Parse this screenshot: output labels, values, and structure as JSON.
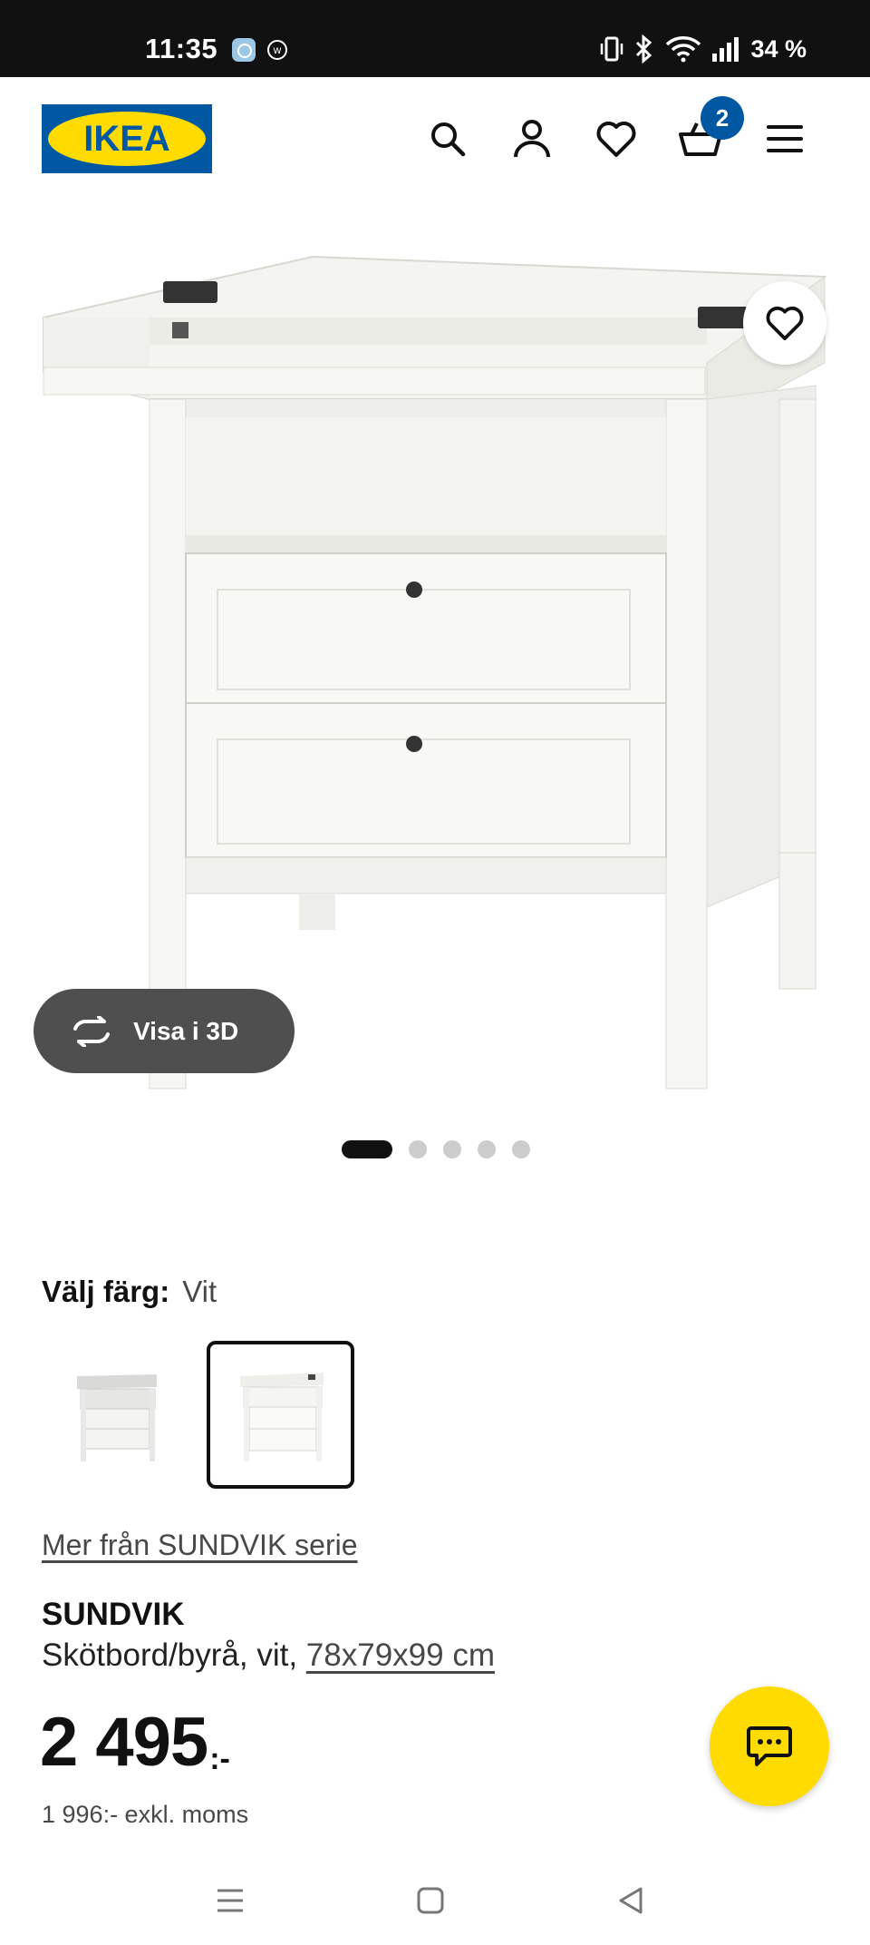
{
  "status_bar": {
    "time": "11:35",
    "battery": "34 %",
    "icons": [
      "vibrate-icon",
      "bluetooth-icon",
      "wifi-icon",
      "signal-icon"
    ]
  },
  "header": {
    "logo_text": "IKEA",
    "icons": [
      "search-icon",
      "account-icon",
      "heart-icon",
      "basket-icon",
      "menu-icon"
    ],
    "basket_count": "2"
  },
  "gallery": {
    "view3d_label": "Visa i 3D",
    "image_count": 5,
    "active_index": 0
  },
  "color": {
    "label": "Välj färg:",
    "value": "Vit",
    "swatches": [
      "grey-white",
      "white"
    ],
    "selected_index": 1
  },
  "product": {
    "series_link": "Mer från SUNDVIK serie",
    "name": "SUNDVIK",
    "description": "Skötbord/byrå, vit, ",
    "dimensions": "78x79x99 cm",
    "price": "2 495",
    "price_suffix": ":-",
    "price_ex_vat": "1 996:- exkl. moms"
  },
  "colors": {
    "ikea_blue": "#0058a3",
    "ikea_yellow": "#ffdb00",
    "dark_pill": "#4f4f4f"
  }
}
